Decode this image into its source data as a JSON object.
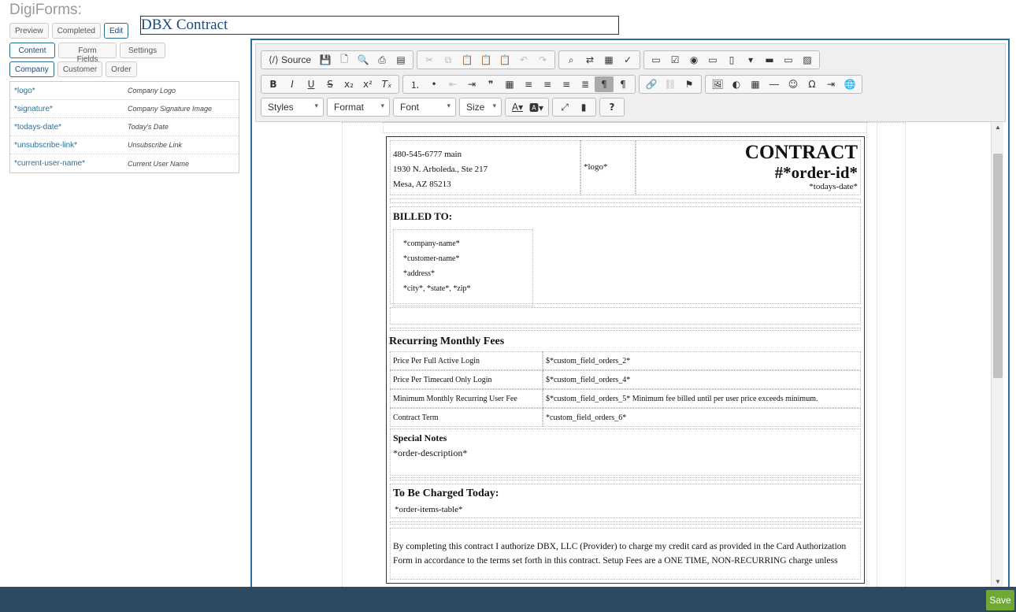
{
  "header": {
    "app_name": "DigiForms:",
    "doc_name": "DBX Contract"
  },
  "mode_tabs": [
    "Preview",
    "Completed",
    "Edit"
  ],
  "panel_tabs": [
    "Content",
    "Form Fields",
    "Settings"
  ],
  "field_tabs": [
    "Company",
    "Customer",
    "Order"
  ],
  "fields": [
    {
      "key": "*logo*",
      "desc": "Company Logo"
    },
    {
      "key": "*signature*",
      "desc": "Company Signature Image"
    },
    {
      "key": "*todays-date*",
      "desc": "Today's Date"
    },
    {
      "key": "*unsubscribe-link*",
      "desc": "Unsubscribe Link"
    },
    {
      "key": "*current-user-name*",
      "desc": "Current User Name"
    }
  ],
  "toolbar": {
    "source_label": "Source",
    "styles": "Styles",
    "format": "Format",
    "font": "Font",
    "size": "Size",
    "help": "?"
  },
  "document": {
    "company_phone": "480-545-6777 main",
    "company_street": "1930 N. Arboleda., Ste 217",
    "company_city": "Mesa, AZ 85213",
    "logo_field": "*logo*",
    "title": "CONTRACT",
    "order_id": "#*order-id*",
    "date_field": "*todays-date*",
    "billed_to_title": "BILLED TO:",
    "billed_lines": [
      "*company-name*",
      "*customer-name*",
      "*address*",
      "*city*, *state*, *zip*"
    ],
    "fees_title": "Recurring Monthly Fees",
    "fees": [
      {
        "label": "Price Per Full Active Login",
        "value": "$*custom_field_orders_2*"
      },
      {
        "label": "Price Per Timecard Only Login",
        "value": "$*custom_field_orders_4*"
      },
      {
        "label": "Minimum Monthly Recurring User Fee",
        "value": "$*custom_field_orders_5*  Minimum fee billed until per user price exceeds minimum."
      },
      {
        "label": "Contract Term",
        "value": "*custom_field_orders_6*"
      }
    ],
    "notes_title": "Special Notes",
    "notes_value": "*order-description*",
    "charged_title": "To Be Charged Today:",
    "charged_value": "*order-items-table*",
    "legal_text": "By completing this contract I authorize DBX, LLC (Provider) to charge my credit card as provided in the Card Authorization Form in accordance to the terms set forth in this contract.  Setup Fees are a ONE TIME, NON-RECURRING charge unless"
  },
  "footer": {
    "save_label": "Save"
  },
  "colors": {
    "accent": "#2a6f99",
    "footer_bg": "#2e4a63",
    "save_bg": "#6fa832"
  }
}
